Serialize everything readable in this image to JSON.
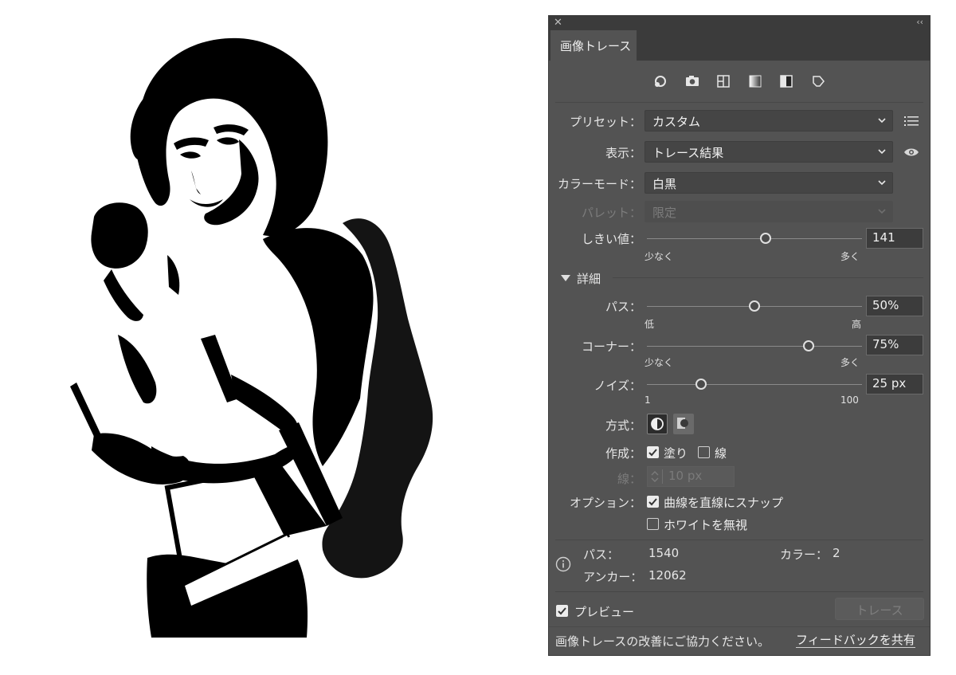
{
  "panel": {
    "tab_title": "画像トレース",
    "icons": [
      "auto-color-icon",
      "camera-icon",
      "low-color-icon",
      "grayscale-icon",
      "black-white-icon",
      "outline-icon"
    ],
    "preset": {
      "label": "プリセット：",
      "value": "カスタム"
    },
    "view": {
      "label": "表示：",
      "value": "トレース結果"
    },
    "color_mode": {
      "label": "カラーモード：",
      "value": "白黒"
    },
    "palette": {
      "label": "パレット：",
      "value": "限定"
    },
    "threshold": {
      "label": "しきい値：",
      "value": "141",
      "level": 0.55,
      "min_label": "少なく",
      "max_label": "多く"
    },
    "advanced": {
      "label": "詳細"
    },
    "paths": {
      "label": "パス：",
      "value": "50%",
      "level": 0.5,
      "min_label": "低",
      "max_label": "高"
    },
    "corners": {
      "label": "コーナー：",
      "value": "75%",
      "level": 0.75,
      "min_label": "少なく",
      "max_label": "多く"
    },
    "noise": {
      "label": "ノイズ：",
      "value": "25 px",
      "level": 0.25,
      "min_label": "1",
      "max_label": "100"
    },
    "method": {
      "label": "方式："
    },
    "create": {
      "label": "作成：",
      "fill_label": "塗り",
      "fill_checked": true,
      "stroke_label": "線",
      "stroke_checked": false
    },
    "stroke": {
      "label": "線：",
      "value": "10 px"
    },
    "options": {
      "label": "オプション：",
      "snap_label": "曲線を直線にスナップ",
      "snap_checked": true,
      "ignore_white_label": "ホワイトを無視",
      "ignore_white_checked": false
    },
    "info": {
      "paths_label": "パス：",
      "paths_value": "1540",
      "colors_label": "カラー：",
      "colors_value": "2",
      "anchors_label": "アンカー：",
      "anchors_value": "12062"
    },
    "preview": {
      "label": "プレビュー",
      "checked": true
    },
    "trace_button": "トレース",
    "feedback_text": "画像トレースの改善にご協力ください。",
    "feedback_link": "フィードバックを共有"
  },
  "colors": {
    "panel_bg": "#535353",
    "header_bg": "#3b3b3b",
    "input_bg": "#454545",
    "text": "#e6e6e6"
  }
}
